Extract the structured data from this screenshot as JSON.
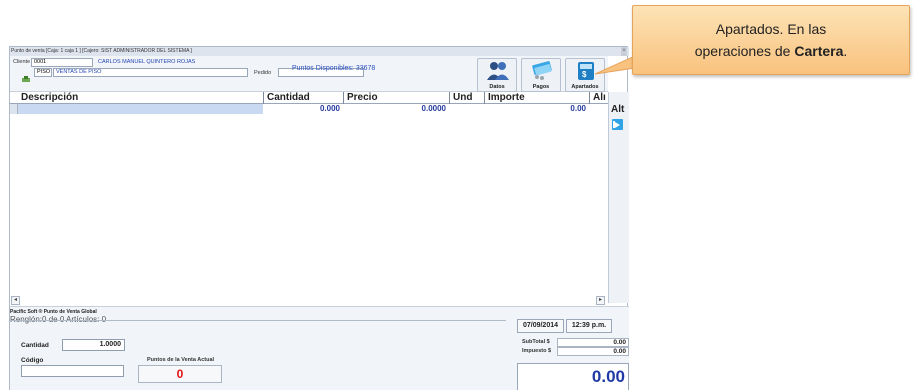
{
  "window": {
    "title": "Punto de venta [Caja: 1 caja 1 ]  [Cajero: SIST  ADMINISTRADOR DEL SISTEMA ]",
    "close_glyph": "×"
  },
  "header": {
    "cliente_label": "Cliente",
    "cliente_code": "0001",
    "cliente_name": "CARLOS MANUEL QUINTERO ROJAS",
    "piso_code": "PISO",
    "piso_name": "VENTAS DE PISO",
    "pedido_label": "Pedido",
    "pedido_value": "",
    "puntos_disponibles": "Puntos Disponibles: 33678"
  },
  "toolbar": {
    "datos_label": "Datos",
    "pagos_label": "Pagos",
    "apartados_label": "Apartados",
    "icons": [
      "users-icon",
      "money-icon",
      "calculator-icon"
    ]
  },
  "grid": {
    "columns": [
      "Descripción",
      "Cantidad",
      "Precio",
      "Und",
      "Importe",
      "Alı"
    ],
    "rows": [
      {
        "descripcion": "",
        "cantidad": "0.000",
        "precio": "0.0000",
        "und": "",
        "importe": "0.00"
      }
    ]
  },
  "side": {
    "alt_label": "Alt"
  },
  "scroll": {
    "left": "◂",
    "right": "▸"
  },
  "footer": {
    "brand": "Pacific Soft ® Punto de Venta Global",
    "renglon": "Renglón:0 de 0   Artículos: 0",
    "fecha": "07/09/2014",
    "hora": "12:39 p.m.",
    "cantidad_label": "Cantidad",
    "cantidad_value": "1.0000",
    "codigo_label": "Código",
    "codigo_value": "",
    "puntos_venta_label": "Puntos de la Venta Actual",
    "puntos_venta_value": "0",
    "subtotal_label": "SubTotal $",
    "subtotal_value": "0.00",
    "impuesto_label": "Impuesto $",
    "impuesto_value": "0.00",
    "total_value": "0.00"
  },
  "callout": {
    "line1": "Apartados. En las",
    "line2_prefix": "operaciones de ",
    "line2_bold": "Cartera",
    "line2_suffix": "."
  },
  "colors": {
    "accent_blue": "#2346b5",
    "points_red": "#e31212",
    "callout_orange": "#f9c27e"
  }
}
